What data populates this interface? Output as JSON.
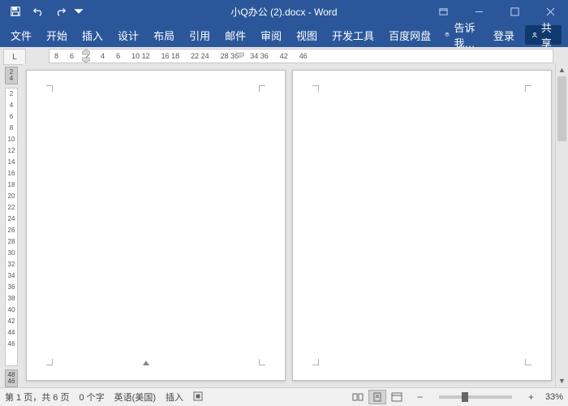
{
  "titlebar": {
    "title": "小Q办公 (2).docx - Word"
  },
  "menu": {
    "file": "文件",
    "home": "开始",
    "insert": "插入",
    "design": "设计",
    "layout": "布局",
    "references": "引用",
    "mailings": "邮件",
    "review": "审阅",
    "view": "视图",
    "developer": "开发工具",
    "baidu": "百度网盘",
    "tell_me": "告诉我…",
    "signin": "登录",
    "share": "共享"
  },
  "ruler": {
    "corner": "L",
    "h_nums": [
      "8",
      "6",
      "2",
      "4",
      "6",
      "10 12",
      "16 18",
      "22 24",
      "28 30",
      "34 36",
      "42",
      "46"
    ],
    "v_top": [
      "2",
      "4"
    ],
    "v_nums": [
      "2",
      "4",
      "6",
      "8",
      "10",
      "12",
      "14",
      "16",
      "18",
      "20",
      "22",
      "24",
      "26",
      "28",
      "30",
      "32",
      "34",
      "36",
      "38",
      "40",
      "42",
      "44",
      "46"
    ],
    "v_bot": [
      "48",
      "46"
    ]
  },
  "status": {
    "page": "第 1 页，共 6 页",
    "words": "0 个字",
    "lang": "英语(美国)",
    "mode": "插入",
    "zoom": "33%"
  }
}
